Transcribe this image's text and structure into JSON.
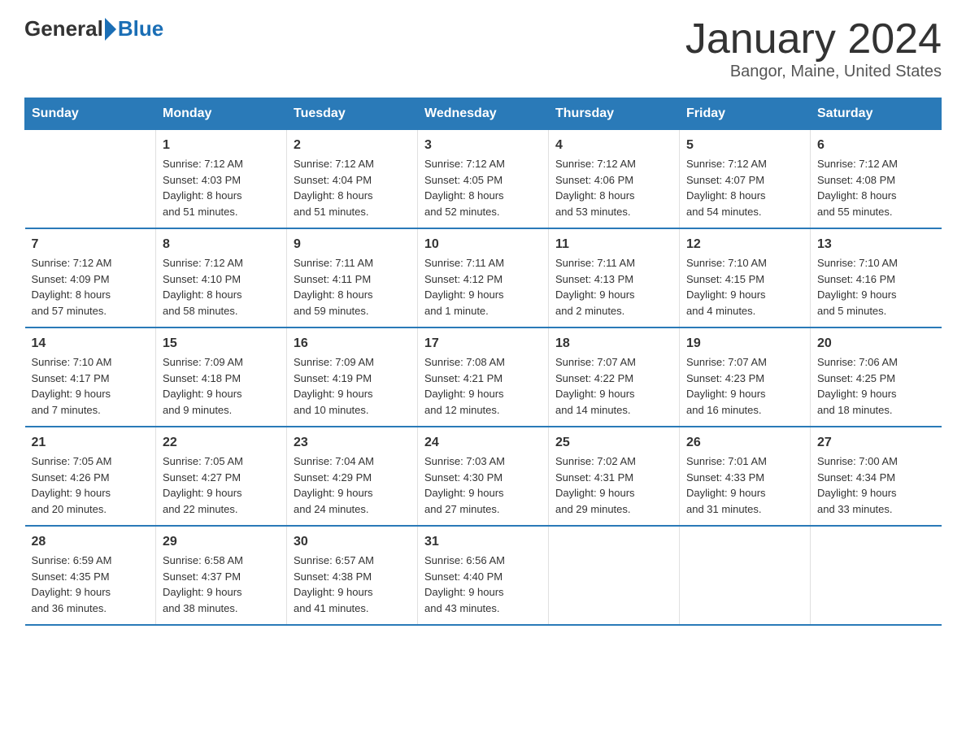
{
  "logo": {
    "general": "General",
    "blue": "Blue"
  },
  "title": "January 2024",
  "subtitle": "Bangor, Maine, United States",
  "days_of_week": [
    "Sunday",
    "Monday",
    "Tuesday",
    "Wednesday",
    "Thursday",
    "Friday",
    "Saturday"
  ],
  "weeks": [
    [
      {
        "day": "",
        "info": ""
      },
      {
        "day": "1",
        "info": "Sunrise: 7:12 AM\nSunset: 4:03 PM\nDaylight: 8 hours\nand 51 minutes."
      },
      {
        "day": "2",
        "info": "Sunrise: 7:12 AM\nSunset: 4:04 PM\nDaylight: 8 hours\nand 51 minutes."
      },
      {
        "day": "3",
        "info": "Sunrise: 7:12 AM\nSunset: 4:05 PM\nDaylight: 8 hours\nand 52 minutes."
      },
      {
        "day": "4",
        "info": "Sunrise: 7:12 AM\nSunset: 4:06 PM\nDaylight: 8 hours\nand 53 minutes."
      },
      {
        "day": "5",
        "info": "Sunrise: 7:12 AM\nSunset: 4:07 PM\nDaylight: 8 hours\nand 54 minutes."
      },
      {
        "day": "6",
        "info": "Sunrise: 7:12 AM\nSunset: 4:08 PM\nDaylight: 8 hours\nand 55 minutes."
      }
    ],
    [
      {
        "day": "7",
        "info": "Sunrise: 7:12 AM\nSunset: 4:09 PM\nDaylight: 8 hours\nand 57 minutes."
      },
      {
        "day": "8",
        "info": "Sunrise: 7:12 AM\nSunset: 4:10 PM\nDaylight: 8 hours\nand 58 minutes."
      },
      {
        "day": "9",
        "info": "Sunrise: 7:11 AM\nSunset: 4:11 PM\nDaylight: 8 hours\nand 59 minutes."
      },
      {
        "day": "10",
        "info": "Sunrise: 7:11 AM\nSunset: 4:12 PM\nDaylight: 9 hours\nand 1 minute."
      },
      {
        "day": "11",
        "info": "Sunrise: 7:11 AM\nSunset: 4:13 PM\nDaylight: 9 hours\nand 2 minutes."
      },
      {
        "day": "12",
        "info": "Sunrise: 7:10 AM\nSunset: 4:15 PM\nDaylight: 9 hours\nand 4 minutes."
      },
      {
        "day": "13",
        "info": "Sunrise: 7:10 AM\nSunset: 4:16 PM\nDaylight: 9 hours\nand 5 minutes."
      }
    ],
    [
      {
        "day": "14",
        "info": "Sunrise: 7:10 AM\nSunset: 4:17 PM\nDaylight: 9 hours\nand 7 minutes."
      },
      {
        "day": "15",
        "info": "Sunrise: 7:09 AM\nSunset: 4:18 PM\nDaylight: 9 hours\nand 9 minutes."
      },
      {
        "day": "16",
        "info": "Sunrise: 7:09 AM\nSunset: 4:19 PM\nDaylight: 9 hours\nand 10 minutes."
      },
      {
        "day": "17",
        "info": "Sunrise: 7:08 AM\nSunset: 4:21 PM\nDaylight: 9 hours\nand 12 minutes."
      },
      {
        "day": "18",
        "info": "Sunrise: 7:07 AM\nSunset: 4:22 PM\nDaylight: 9 hours\nand 14 minutes."
      },
      {
        "day": "19",
        "info": "Sunrise: 7:07 AM\nSunset: 4:23 PM\nDaylight: 9 hours\nand 16 minutes."
      },
      {
        "day": "20",
        "info": "Sunrise: 7:06 AM\nSunset: 4:25 PM\nDaylight: 9 hours\nand 18 minutes."
      }
    ],
    [
      {
        "day": "21",
        "info": "Sunrise: 7:05 AM\nSunset: 4:26 PM\nDaylight: 9 hours\nand 20 minutes."
      },
      {
        "day": "22",
        "info": "Sunrise: 7:05 AM\nSunset: 4:27 PM\nDaylight: 9 hours\nand 22 minutes."
      },
      {
        "day": "23",
        "info": "Sunrise: 7:04 AM\nSunset: 4:29 PM\nDaylight: 9 hours\nand 24 minutes."
      },
      {
        "day": "24",
        "info": "Sunrise: 7:03 AM\nSunset: 4:30 PM\nDaylight: 9 hours\nand 27 minutes."
      },
      {
        "day": "25",
        "info": "Sunrise: 7:02 AM\nSunset: 4:31 PM\nDaylight: 9 hours\nand 29 minutes."
      },
      {
        "day": "26",
        "info": "Sunrise: 7:01 AM\nSunset: 4:33 PM\nDaylight: 9 hours\nand 31 minutes."
      },
      {
        "day": "27",
        "info": "Sunrise: 7:00 AM\nSunset: 4:34 PM\nDaylight: 9 hours\nand 33 minutes."
      }
    ],
    [
      {
        "day": "28",
        "info": "Sunrise: 6:59 AM\nSunset: 4:35 PM\nDaylight: 9 hours\nand 36 minutes."
      },
      {
        "day": "29",
        "info": "Sunrise: 6:58 AM\nSunset: 4:37 PM\nDaylight: 9 hours\nand 38 minutes."
      },
      {
        "day": "30",
        "info": "Sunrise: 6:57 AM\nSunset: 4:38 PM\nDaylight: 9 hours\nand 41 minutes."
      },
      {
        "day": "31",
        "info": "Sunrise: 6:56 AM\nSunset: 4:40 PM\nDaylight: 9 hours\nand 43 minutes."
      },
      {
        "day": "",
        "info": ""
      },
      {
        "day": "",
        "info": ""
      },
      {
        "day": "",
        "info": ""
      }
    ]
  ]
}
